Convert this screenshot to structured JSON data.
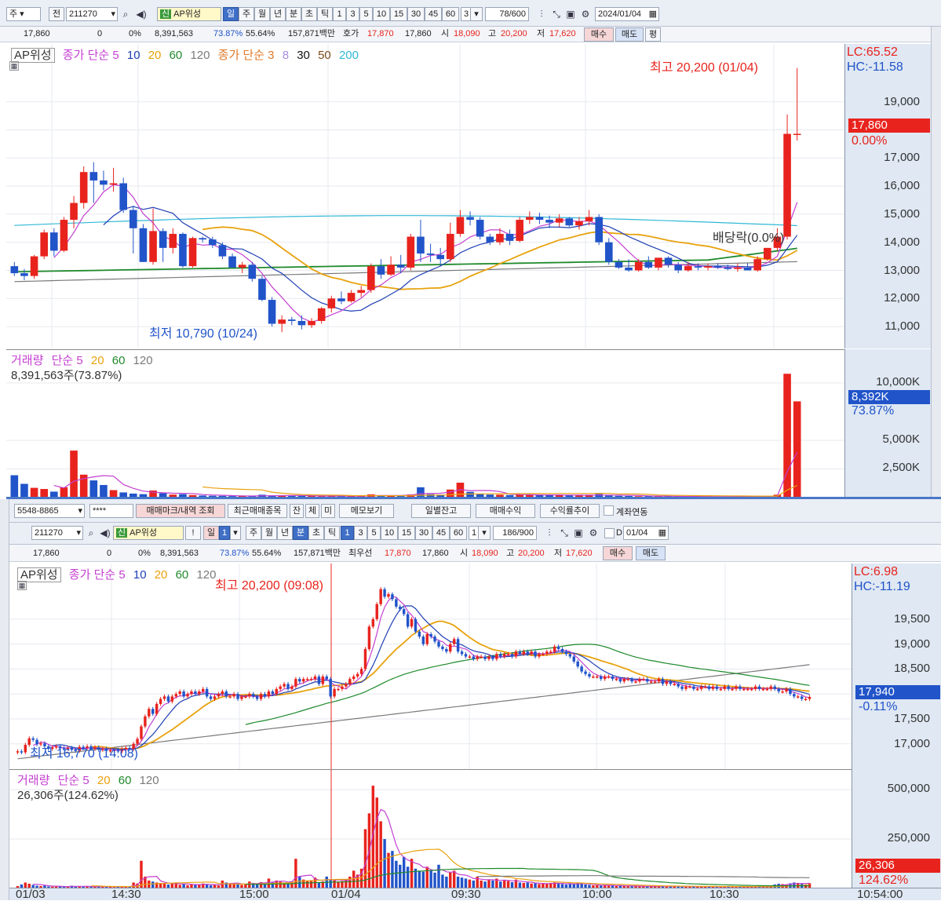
{
  "top": {
    "toolbar": {
      "type_label": "주",
      "prev_label": "전",
      "code": "211270",
      "name": "AP위성",
      "name_badge": "신",
      "periods": [
        "일",
        "주",
        "월",
        "년",
        "분",
        "초",
        "틱"
      ],
      "intervals": [
        "1",
        "3",
        "5",
        "10",
        "15",
        "30",
        "45",
        "60"
      ],
      "count_value": "3",
      "page_count": "78/600",
      "date": "2024/01/04"
    },
    "quote": {
      "price": "17,860",
      "change": "0",
      "rate": "0%",
      "volume": "8,391,563",
      "vol_ratio": "73.87%",
      "vol_ratio2": "55.64%",
      "amount": "157,871백만",
      "bid_label": "호가",
      "bid": "17,870",
      "ask": "17,860",
      "open_label": "시",
      "open": "18,090",
      "high_label": "고",
      "high": "20,200",
      "low_label": "저",
      "low": "17,620",
      "buy": "매수",
      "sell": "매도",
      "avg": "평"
    },
    "price_chart": {
      "legend": [
        "AP위성",
        "종가 단순 5",
        "10",
        "20",
        "60",
        "120",
        "종가 단순 3",
        "8",
        "30",
        "50",
        "200"
      ],
      "lc": "LC:65.52",
      "hc": "HC:-11.58",
      "yticks": [
        "19,000",
        "17,000",
        "16,000",
        "15,000",
        "14,000",
        "13,000",
        "12,000",
        "11,000"
      ],
      "last_price": "17,860",
      "last_change": "0.00%",
      "high_note": "최고 20,200 (01/04)",
      "low_note": "최저 10,790 (10/24)",
      "dividend_note": "배당락(0.0%)"
    },
    "volume_chart": {
      "legend": [
        "거래량",
        "단순 5",
        "20",
        "60",
        "120"
      ],
      "value_text": "8,391,563주(73.87%)",
      "yticks": [
        "10,000K",
        "5,000K",
        "2,500K"
      ],
      "last_volume": "8,392K",
      "last_ratio": "73.87%"
    }
  },
  "bottom": {
    "toolbar1": {
      "account": "5548-8865",
      "password": "****",
      "buttons": [
        "매매마크/내역 조회",
        "최근매매종목",
        "잔",
        "체",
        "미",
        "메모보기",
        "일별잔고",
        "매매수익",
        "수익률추이"
      ],
      "checkbox_label": "계좌연동"
    },
    "toolbar2": {
      "code": "211270",
      "name": "AP위성",
      "name_badge": "신",
      "bang": "!",
      "day_label": "일",
      "day_value": "1",
      "periods": [
        "주",
        "월",
        "년",
        "분",
        "초",
        "틱"
      ],
      "intervals": [
        "1",
        "3",
        "5",
        "10",
        "15",
        "30",
        "45",
        "60"
      ],
      "count_value": "1",
      "page_count": "186/900",
      "d_label": "D",
      "date": "01/04"
    },
    "quote": {
      "price": "17,860",
      "change": "0",
      "rate": "0%",
      "volume": "8,391,563",
      "vol_ratio": "73.87%",
      "vol_ratio2": "55.64%",
      "amount": "157,871백만",
      "bid_label": "최우선",
      "bid": "17,870",
      "ask": "17,860",
      "open_label": "시",
      "open": "18,090",
      "high_label": "고",
      "high": "20,200",
      "low_label": "저",
      "low": "17,620",
      "buy": "매수",
      "sell": "매도"
    },
    "price_chart": {
      "legend": [
        "AP위성",
        "종가 단순 5",
        "10",
        "20",
        "60",
        "120"
      ],
      "lc": "LC:6.98",
      "hc": "HC:-11.19",
      "yticks": [
        "19,500",
        "19,000",
        "18,500",
        "17,500",
        "17,000"
      ],
      "last_price": "17,940",
      "last_change": "-0.11%",
      "high_note": "최고 20,200 (09:08)",
      "low_note": "최저 16,770 (14:08)"
    },
    "volume_chart": {
      "legend": [
        "거래량",
        "단순 5",
        "20",
        "60",
        "120"
      ],
      "value_text": "26,306주(124.62%)",
      "yticks": [
        "500,000",
        "250,000"
      ],
      "last_volume": "26,306",
      "last_ratio": "124.62%"
    },
    "time_axis": [
      "01/03",
      "14:30",
      "15:00",
      "01/04",
      "09:30",
      "10:00",
      "10:30",
      "10:54:00"
    ]
  },
  "colors": {
    "up": "#e8231d",
    "down": "#2154c9",
    "ma5": "#c43fd1",
    "ma10": "#1f3fb5",
    "ma20": "#e8a20e",
    "ma60": "#1f8a2b",
    "ma120": "#7a7a7a",
    "ma200": "#30b8d6",
    "axis_bg": "#dfe8f3"
  },
  "chart_data": [
    {
      "type": "candlestick",
      "title": "AP위성",
      "timeframe": "daily",
      "ylim": [
        10500,
        20500
      ],
      "ohlc": [
        [
          13150,
          13300,
          12800,
          12900
        ],
        [
          12900,
          13050,
          12650,
          12800
        ],
        [
          12800,
          13550,
          12700,
          13500
        ],
        [
          13500,
          14450,
          13400,
          14350
        ],
        [
          14350,
          14500,
          13500,
          13700
        ],
        [
          13700,
          14900,
          13650,
          14800
        ],
        [
          14800,
          15650,
          14500,
          15400
        ],
        [
          15400,
          16700,
          15200,
          16500
        ],
        [
          16500,
          16850,
          15400,
          16200
        ],
        [
          16200,
          16550,
          15850,
          16050
        ],
        [
          16050,
          16650,
          15800,
          16100
        ],
        [
          16100,
          16300,
          15050,
          15150
        ],
        [
          15150,
          15300,
          13600,
          14500
        ],
        [
          14500,
          14650,
          13300,
          13300
        ],
        [
          13300,
          15200,
          13200,
          14400
        ],
        [
          14400,
          14500,
          13300,
          13800
        ],
        [
          13800,
          14500,
          13600,
          14300
        ],
        [
          14300,
          14350,
          13100,
          13150
        ],
        [
          13150,
          14200,
          13100,
          14150
        ],
        [
          14150,
          14200,
          14000,
          14100
        ],
        [
          14100,
          14200,
          13800,
          13900
        ],
        [
          13900,
          14000,
          13400,
          13500
        ],
        [
          13500,
          13600,
          13100,
          13100
        ],
        [
          13100,
          13300,
          12900,
          13200
        ],
        [
          13200,
          13300,
          12600,
          12700
        ],
        [
          12700,
          12800,
          11900,
          11950
        ],
        [
          11950,
          12050,
          11000,
          11100
        ],
        [
          11100,
          11400,
          10800,
          11250
        ],
        [
          11250,
          11350,
          11050,
          11200
        ],
        [
          11200,
          11400,
          10900,
          11050
        ],
        [
          11050,
          11300,
          10950,
          11200
        ],
        [
          11200,
          11700,
          11100,
          11650
        ],
        [
          11650,
          12100,
          11500,
          12000
        ],
        [
          12000,
          12250,
          11800,
          11900
        ],
        [
          11900,
          12300,
          11850,
          12200
        ],
        [
          12200,
          12450,
          12050,
          12300
        ],
        [
          12300,
          13250,
          12200,
          13150
        ],
        [
          13150,
          13400,
          12700,
          12850
        ],
        [
          12850,
          13500,
          12800,
          13200
        ],
        [
          13200,
          13550,
          12900,
          13100
        ],
        [
          13100,
          14300,
          13000,
          14200
        ],
        [
          14200,
          14800,
          13300,
          13600
        ],
        [
          13600,
          13950,
          13300,
          13550
        ],
        [
          13550,
          13800,
          13150,
          13400
        ],
        [
          13400,
          14700,
          13300,
          14300
        ],
        [
          14300,
          15150,
          14200,
          14900
        ],
        [
          14900,
          15100,
          14600,
          14800
        ],
        [
          14800,
          14900,
          14100,
          14200
        ],
        [
          14200,
          14300,
          13900,
          14000
        ],
        [
          14000,
          14500,
          13900,
          14300
        ],
        [
          14300,
          14450,
          13900,
          14050
        ],
        [
          14050,
          14900,
          14000,
          14800
        ],
        [
          14800,
          15100,
          14650,
          14900
        ],
        [
          14900,
          15050,
          14650,
          14800
        ],
        [
          14800,
          14950,
          14500,
          14700
        ],
        [
          14700,
          15000,
          14550,
          14850
        ],
        [
          14850,
          14900,
          14550,
          14600
        ],
        [
          14600,
          14900,
          14450,
          14750
        ],
        [
          14750,
          15150,
          14600,
          14900
        ],
        [
          14900,
          15000,
          13900,
          14000
        ],
        [
          14000,
          14150,
          13200,
          13300
        ],
        [
          13300,
          13400,
          13050,
          13100
        ],
        [
          13100,
          13400,
          12950,
          13000
        ],
        [
          13000,
          13400,
          12950,
          13300
        ],
        [
          13300,
          13500,
          13050,
          13100
        ],
        [
          13100,
          13450,
          13000,
          13450
        ],
        [
          13450,
          13500,
          13100,
          13200
        ],
        [
          13200,
          13300,
          12900,
          13000
        ],
        [
          13000,
          13300,
          12950,
          13150
        ],
        [
          13150,
          13250,
          13000,
          13100
        ],
        [
          13100,
          13250,
          13000,
          13150
        ],
        [
          13150,
          13250,
          13050,
          13100
        ],
        [
          13100,
          13200,
          13000,
          13050
        ],
        [
          13050,
          13250,
          12950,
          13100
        ],
        [
          13100,
          13250,
          13000,
          13000
        ],
        [
          13000,
          13500,
          12950,
          13400
        ],
        [
          13400,
          13800,
          13350,
          13800
        ],
        [
          13800,
          14500,
          13700,
          14200
        ],
        [
          14200,
          18550,
          14100,
          17860
        ],
        [
          17860,
          20200,
          17620,
          17860
        ]
      ],
      "volume_k": [
        1950,
        1200,
        850,
        750,
        520,
        900,
        4100,
        2000,
        1500,
        1100,
        650,
        450,
        350,
        300,
        620,
        380,
        260,
        300,
        220,
        180,
        160,
        150,
        130,
        140,
        120,
        250,
        180,
        160,
        170,
        150,
        140,
        110,
        130,
        150,
        140,
        120,
        280,
        200,
        180,
        160,
        270,
        900,
        300,
        250,
        700,
        1300,
        500,
        320,
        260,
        250,
        220,
        240,
        250,
        210,
        230,
        220,
        200,
        190,
        210,
        320,
        180,
        150,
        140,
        120,
        130,
        110,
        100,
        90,
        90,
        80,
        80,
        70,
        70,
        80,
        90,
        110,
        150,
        250,
        10800,
        8392
      ]
    },
    {
      "type": "candlestick",
      "title": "AP위성",
      "timeframe": "1-minute",
      "ylim": [
        16650,
        20300
      ],
      "close": [
        16850,
        16830,
        16980,
        17110,
        17080,
        16990,
        17010,
        16950,
        16900,
        16930,
        16950,
        16910,
        16900,
        16920,
        16880,
        16860,
        16940,
        16920,
        16950,
        16900,
        16930,
        16880,
        16900,
        16860,
        16870,
        16880,
        16850,
        16900,
        16920,
        16900,
        17000,
        17100,
        17350,
        17550,
        17700,
        17600,
        17800,
        17900,
        17950,
        17850,
        17950,
        18000,
        18050,
        17950,
        18000,
        18050,
        18000,
        18050,
        18100,
        17950,
        17900,
        17950,
        18000,
        18050,
        17950,
        17950,
        18000,
        17900,
        17950,
        17950,
        18000,
        17950,
        17900,
        18000,
        17950,
        18050,
        18000,
        18100,
        18150,
        18200,
        18100,
        18150,
        18300,
        18250,
        18300,
        18300,
        18300,
        18350,
        18200,
        18350,
        18300,
        17950,
        18100,
        18100,
        18150,
        18200,
        18300,
        18350,
        18400,
        18500,
        18900,
        19350,
        19500,
        19800,
        20100,
        19950,
        20000,
        19900,
        19750,
        19700,
        19600,
        19350,
        19500,
        19250,
        19150,
        19000,
        19200,
        19150,
        19050,
        18950,
        18900,
        18850,
        19000,
        19100,
        18850,
        18800,
        18750,
        18750,
        18700,
        18750,
        18750,
        18700,
        18750,
        18700,
        18800,
        18750,
        18800,
        18800,
        18750,
        18850,
        18800,
        18850,
        18800,
        18850,
        18750,
        18800,
        18800,
        18850,
        18850,
        18950,
        18900,
        18850,
        18800,
        18750,
        18650,
        18550,
        18450,
        18400,
        18350,
        18350,
        18350,
        18300,
        18350,
        18350,
        18300,
        18300,
        18250,
        18300,
        18300,
        18250,
        18250,
        18300,
        18300,
        18250,
        18250,
        18250,
        18300,
        18200,
        18250,
        18200,
        18200,
        18150,
        18100,
        18150,
        18150,
        18100,
        18100,
        18150,
        18150,
        18100,
        18150,
        18100,
        18100,
        18150,
        18100,
        18100,
        18150,
        18100,
        18100,
        18100,
        18100,
        18150,
        18100,
        18100,
        18100,
        18150,
        18100,
        18050,
        18050,
        18100,
        18000,
        17950,
        17950,
        17900,
        17900,
        17940
      ],
      "volume": [
        12000,
        20000,
        30000,
        24000,
        18000,
        14000,
        12000,
        15000,
        10000,
        9000,
        11000,
        10000,
        9000,
        8000,
        14000,
        10000,
        12000,
        9000,
        10000,
        8000,
        9000,
        11000,
        8000,
        10000,
        9000,
        7000,
        9000,
        12000,
        8000,
        10000,
        30000,
        25000,
        140000,
        60000,
        40000,
        35000,
        30000,
        28000,
        25000,
        20000,
        25000,
        30000,
        18000,
        22000,
        16000,
        20000,
        22000,
        18000,
        25000,
        20000,
        16000,
        18000,
        15000,
        40000,
        30000,
        22000,
        25000,
        20000,
        18000,
        22000,
        35000,
        28000,
        22000,
        32000,
        25000,
        50000,
        30000,
        40000,
        35000,
        30000,
        28000,
        35000,
        150000,
        60000,
        45000,
        40000,
        42000,
        55000,
        30000,
        35000,
        60000,
        45000,
        40000,
        35000,
        38000,
        45000,
        60000,
        90000,
        70000,
        100000,
        300000,
        380000,
        520000,
        460000,
        340000,
        250000,
        180000,
        190000,
        140000,
        120000,
        160000,
        110000,
        150000,
        100000,
        90000,
        85000,
        110000,
        90000,
        80000,
        120000,
        70000,
        60000,
        80000,
        90000,
        60000,
        55000,
        50000,
        45000,
        40000,
        60000,
        40000,
        35000,
        45000,
        40000,
        50000,
        35000,
        40000,
        38000,
        32000,
        45000,
        30000,
        28000,
        30000,
        25000,
        26000,
        22000,
        25000,
        24000,
        28000,
        30000,
        24000,
        22000,
        20000,
        25000,
        22000,
        30000,
        24000,
        20000,
        18000,
        16000,
        16000,
        14000,
        18000,
        15000,
        14000,
        12000,
        14000,
        13000,
        12000,
        11000,
        12000,
        10000,
        11000,
        10000,
        12000,
        11000,
        10000,
        12000,
        10000,
        11000,
        12000,
        10000,
        9000,
        11000,
        9000,
        10000,
        11000,
        9000,
        8000,
        9000,
        9000,
        8000,
        10000,
        9000,
        8000,
        9000,
        10000,
        8000,
        8000,
        9000,
        8000,
        10000,
        8000,
        9000,
        8000,
        12000,
        20000,
        24000,
        22000,
        18000,
        26000,
        30000,
        28000,
        24000,
        20000,
        26306
      ]
    }
  ]
}
